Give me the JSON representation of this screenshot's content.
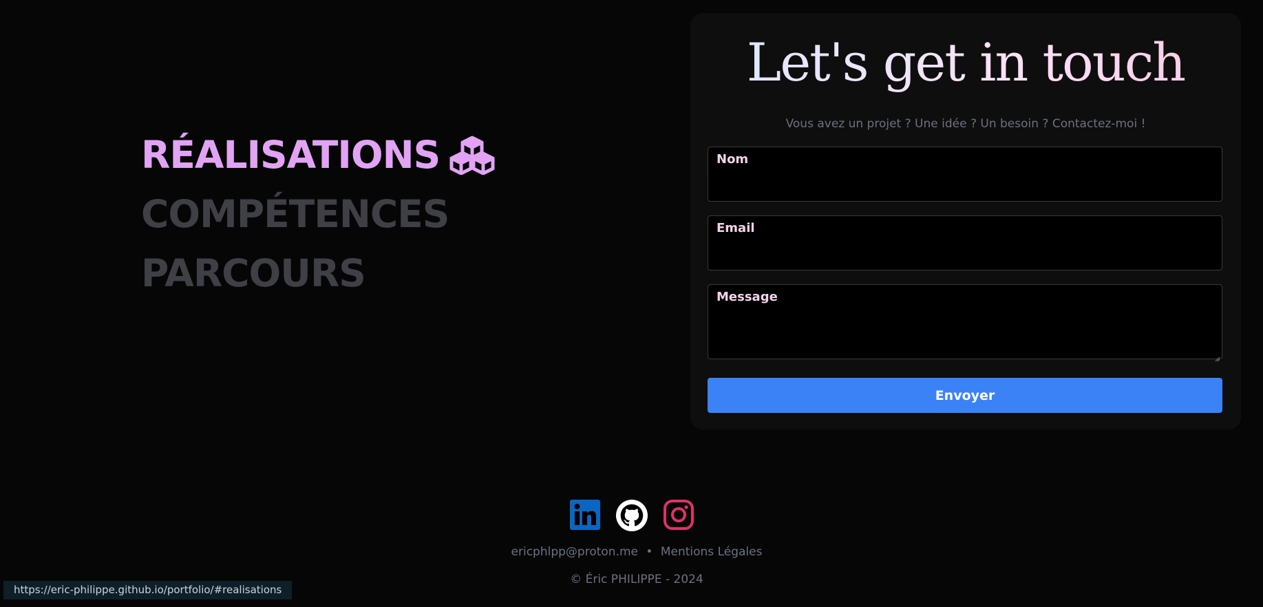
{
  "nav": {
    "items": [
      {
        "label": "RÉALISATIONS",
        "active": true
      },
      {
        "label": "COMPÉTENCES",
        "active": false
      },
      {
        "label": "PARCOURS",
        "active": false
      }
    ],
    "active_icon": "cubes-icon"
  },
  "contact": {
    "title": "Let's get in touch",
    "subtitle": "Vous avez un projet ? Une idée ? Un besoin ? Contactez-moi !",
    "fields": {
      "name": {
        "label": "Nom",
        "value": ""
      },
      "email": {
        "label": "Email",
        "value": ""
      },
      "message": {
        "label": "Message",
        "value": ""
      }
    },
    "submit_label": "Envoyer"
  },
  "footer": {
    "socials": [
      "linkedin-icon",
      "github-icon",
      "instagram-icon"
    ],
    "email": "ericphlpp@proton.me",
    "separator": "•",
    "legal_label": "Mentions Légales",
    "copyright": "© Éric PHILIPPE - 2024"
  },
  "status_bar": {
    "url": "https://eric-philippe.github.io/portfolio/#realisations"
  },
  "colors": {
    "background": "#060606",
    "card": "#0e0e0e",
    "active_nav": "#e2a3f5",
    "inactive_nav": "#3f3f46",
    "button": "#3b82f6",
    "linkedin": "#0a66c2",
    "instagram": "#e1306c"
  }
}
